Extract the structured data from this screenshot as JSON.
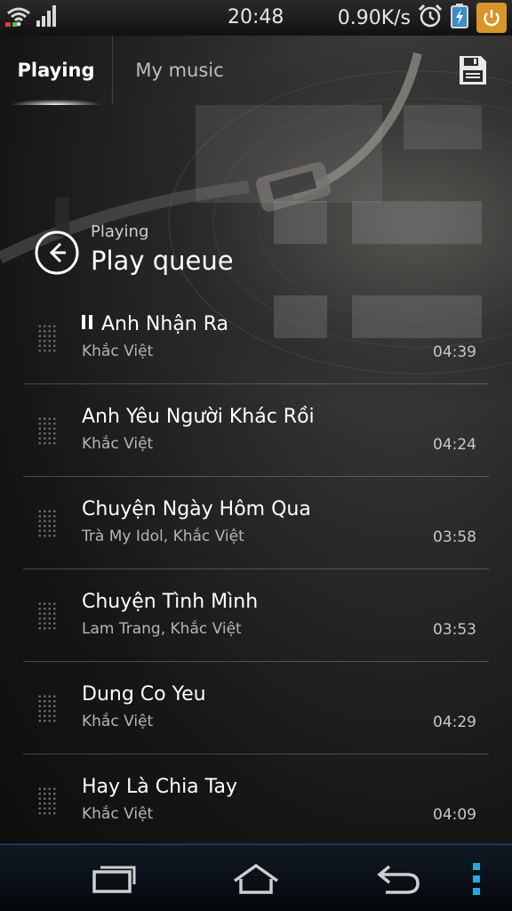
{
  "status_bar": {
    "time": "20:48",
    "net_speed": "0.90K/s",
    "icons": [
      "wifi-icon",
      "signal-icon",
      "alarm-icon",
      "battery-charging-icon",
      "power-icon"
    ],
    "power_color": "#d9952a"
  },
  "tabs": [
    {
      "label": "Playing",
      "active": true
    },
    {
      "label": "My music",
      "active": false
    }
  ],
  "toolbar": {
    "save_icon": "save-icon"
  },
  "header": {
    "subtitle": "Playing",
    "title": "Play queue",
    "back_icon": "back-arrow-icon"
  },
  "queue": [
    {
      "title": "Anh Nhận Ra",
      "artist": "Khắc Việt",
      "duration": "04:39",
      "now_playing": true
    },
    {
      "title": "Anh Yêu Người Khác Rồi",
      "artist": "Khắc Việt",
      "duration": "04:24"
    },
    {
      "title": "Chuyện Ngày Hôm Qua",
      "artist": "Trà My Idol, Khắc Việt",
      "duration": "03:58"
    },
    {
      "title": "Chuyện Tình Mình",
      "artist": "Lam Trang, Khắc Việt",
      "duration": "03:53"
    },
    {
      "title": "Dung Co Yeu",
      "artist": "Khắc Việt",
      "duration": "04:29"
    },
    {
      "title": "Hay Là Chia Tay",
      "artist": "Khắc Việt",
      "duration": "04:09"
    }
  ],
  "nav_bar": {
    "icons": [
      "recent-apps-icon",
      "home-icon",
      "back-icon",
      "menu-icon"
    ],
    "menu_color": "#2aa7d6"
  }
}
